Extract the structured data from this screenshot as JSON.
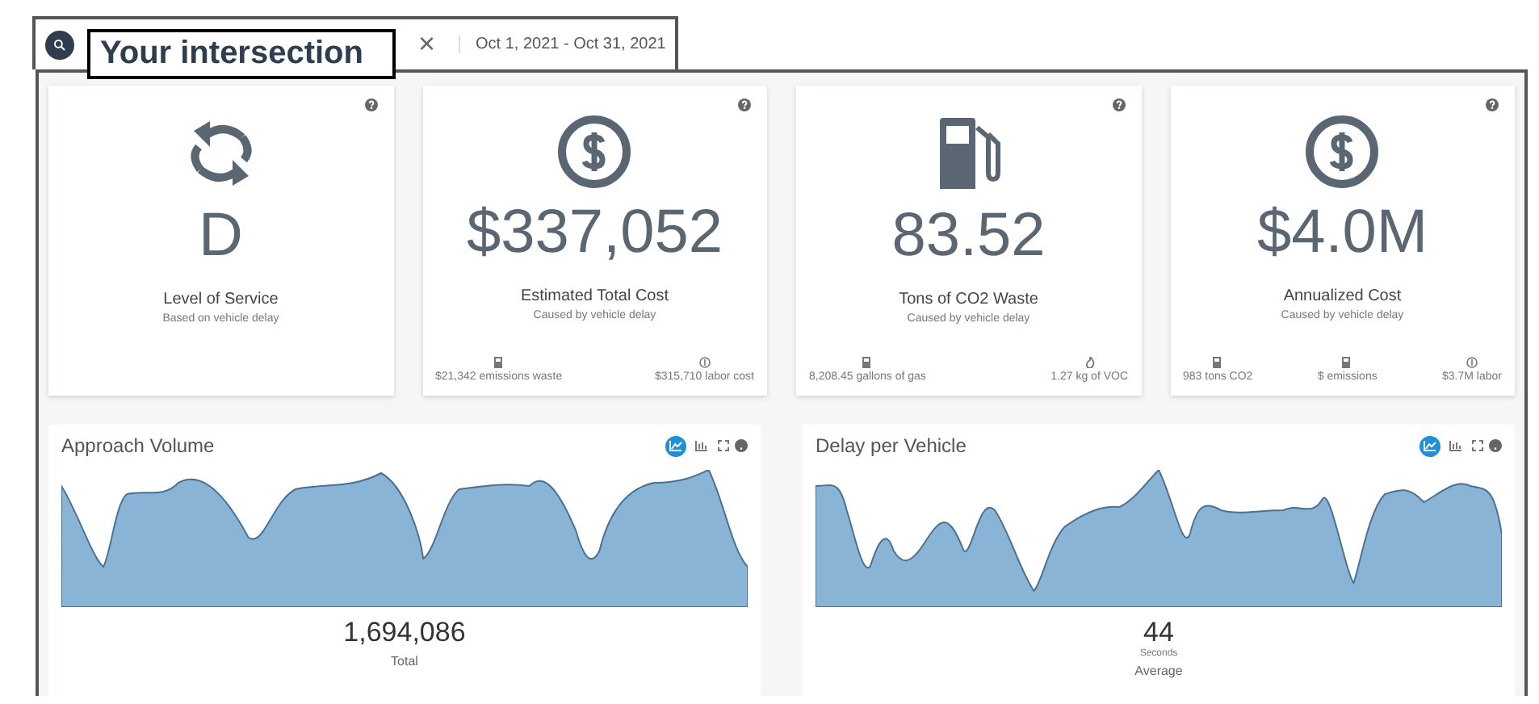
{
  "search_bar": {
    "title": "Your intersection",
    "close": "×",
    "date_range": "Oct 1, 2021 - Oct 31, 2021"
  },
  "kpis": [
    {
      "kind": "cycle",
      "value": "D",
      "label": "Level of Service",
      "sublabel": "Based on vehicle delay"
    },
    {
      "kind": "dollar",
      "value": "$337,052",
      "label": "Estimated Total Cost",
      "sublabel": "Caused by vehicle delay",
      "stats": [
        {
          "kind": "fuel",
          "text": "$21,342 emissions waste"
        },
        {
          "kind": "dollar",
          "text": "$315,710 labor cost"
        }
      ]
    },
    {
      "kind": "fuel",
      "value": "83.52",
      "label": "Tons of CO2 Waste",
      "sublabel": "Caused by vehicle delay",
      "stats": [
        {
          "kind": "fuel",
          "text": "8,208.45 gallons of gas"
        },
        {
          "kind": "flame",
          "text": "1.27 kg of VOC"
        }
      ]
    },
    {
      "kind": "dollar",
      "value": "$4.0M",
      "label": "Annualized Cost",
      "sublabel": "Caused by vehicle delay",
      "stats": [
        {
          "kind": "fuel",
          "text": "983 tons CO2"
        },
        {
          "kind": "fuel",
          "text": "$ emissions"
        },
        {
          "kind": "dollar",
          "text": "$3.7M labor"
        }
      ]
    }
  ],
  "charts": [
    {
      "title": "Approach Volume",
      "views": [
        {
          "kind": "line",
          "selected": true
        },
        {
          "kind": "bar",
          "selected": false
        }
      ],
      "value": "1,694,086",
      "caption": "Total"
    },
    {
      "title": "Delay per Vehicle",
      "views": [
        {
          "kind": "line",
          "selected": true
        },
        {
          "kind": "bar",
          "selected": false
        }
      ],
      "value": "44",
      "unit": "Seconds",
      "caption": "Average"
    }
  ]
}
